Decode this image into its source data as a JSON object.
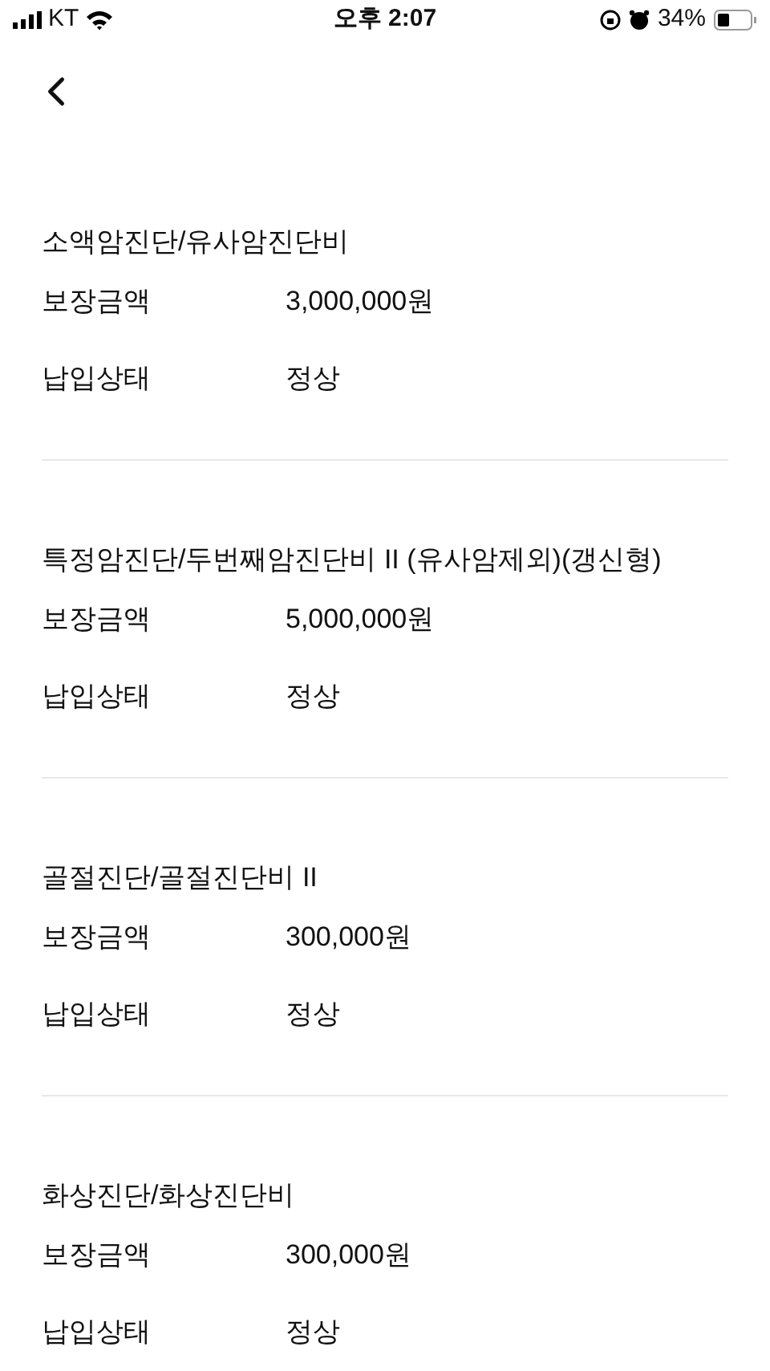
{
  "status_bar": {
    "carrier": "KT",
    "time": "오후 2:07",
    "battery": "34%"
  },
  "sections": [
    {
      "title": "소액암진단/유사암진단비",
      "rows": [
        {
          "label": "보장금액",
          "value": "3,000,000원"
        },
        {
          "label": "납입상태",
          "value": "정상"
        }
      ]
    },
    {
      "title": "특정암진단/두번째암진단비 II (유사암제외)(갱신형)",
      "rows": [
        {
          "label": "보장금액",
          "value": "5,000,000원"
        },
        {
          "label": "납입상태",
          "value": "정상"
        }
      ]
    },
    {
      "title": "골절진단/골절진단비 II",
      "rows": [
        {
          "label": "보장금액",
          "value": "300,000원"
        },
        {
          "label": "납입상태",
          "value": "정상"
        }
      ]
    },
    {
      "title": "화상진단/화상진단비",
      "rows": [
        {
          "label": "보장금액",
          "value": "300,000원"
        },
        {
          "label": "납입상태",
          "value": "정상"
        }
      ]
    }
  ]
}
